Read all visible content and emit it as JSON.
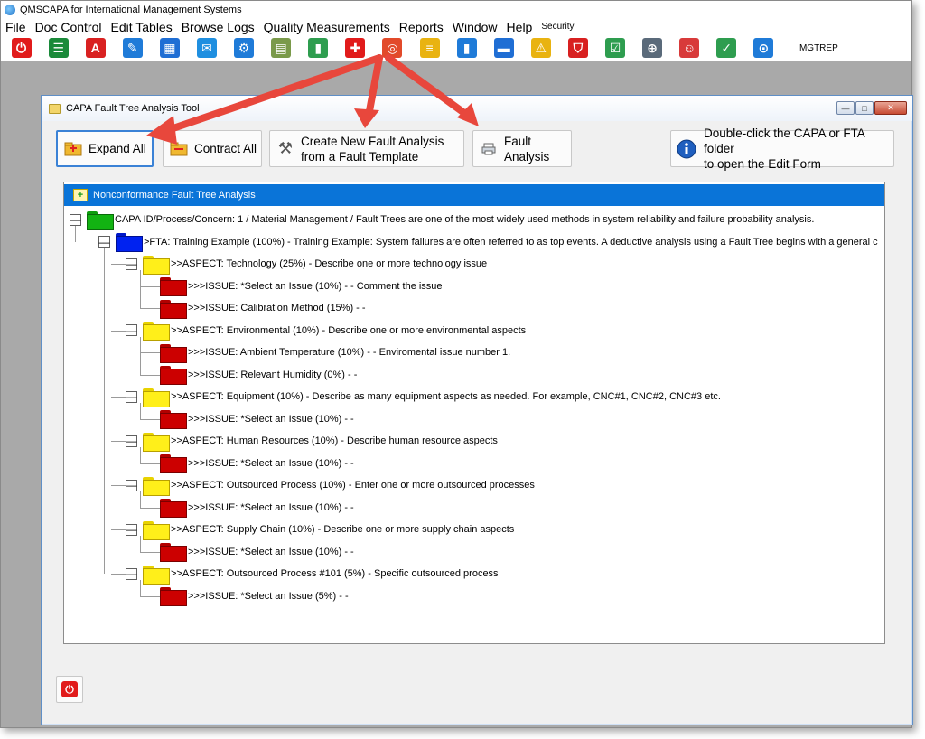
{
  "app": {
    "title": "QMSCAPA for International Management Systems"
  },
  "menu": [
    {
      "label": "File"
    },
    {
      "label": "Doc Control"
    },
    {
      "label": "Edit Tables"
    },
    {
      "label": "Browse Logs"
    },
    {
      "label": "Quality Measurements"
    },
    {
      "label": "Reports"
    },
    {
      "label": "Window"
    },
    {
      "label": "Help"
    },
    {
      "label": "Security",
      "small": true
    }
  ],
  "toolbar": {
    "icons": [
      {
        "name": "power-icon",
        "glyph": "⏻",
        "color": "#e11b1b"
      },
      {
        "name": "document-list-icon",
        "glyph": "☰",
        "color": "#1a8a3a"
      },
      {
        "name": "pdf-icon",
        "glyph": "A",
        "color": "#d92121"
      },
      {
        "name": "edit-pencil-icon",
        "glyph": "✎",
        "color": "#1f7bd8"
      },
      {
        "name": "org-chart-icon",
        "glyph": "▦",
        "color": "#1f6ed4"
      },
      {
        "name": "chat-icon",
        "glyph": "✉",
        "color": "#1f8fe0"
      },
      {
        "name": "gear-icon",
        "glyph": "⚙",
        "color": "#1f7bd8"
      },
      {
        "name": "calendar-icon",
        "glyph": "▤",
        "color": "#7a9a4a"
      },
      {
        "name": "book-icon",
        "glyph": "▮",
        "color": "#2e9d4f"
      },
      {
        "name": "red-cross-icon",
        "glyph": "✚",
        "color": "#e11b1b"
      },
      {
        "name": "lifebuoy-icon",
        "glyph": "◎",
        "color": "#e24a2a"
      },
      {
        "name": "notepad-icon",
        "glyph": "≡",
        "color": "#e9b311"
      },
      {
        "name": "bar-chart-icon",
        "glyph": "▮",
        "color": "#1f7bd8"
      },
      {
        "name": "printer-icon",
        "glyph": "▬",
        "color": "#1f6ed4"
      },
      {
        "name": "warning-icon",
        "glyph": "⚠",
        "color": "#e9b311"
      },
      {
        "name": "shield-icon",
        "glyph": "⛉",
        "color": "#d82020"
      },
      {
        "name": "checklist-icon",
        "glyph": "☑",
        "color": "#2e9d4f"
      },
      {
        "name": "database-add-icon",
        "glyph": "⊕",
        "color": "#5a6a7a"
      },
      {
        "name": "user-profile-icon",
        "glyph": "☺",
        "color": "#d83a3a"
      },
      {
        "name": "clipboard-check-icon",
        "glyph": "✓",
        "color": "#2e9d4f"
      },
      {
        "name": "globe-search-icon",
        "glyph": "⊙",
        "color": "#1f7bd8"
      }
    ],
    "mgtrep_label": "MGTREP"
  },
  "window": {
    "title": "CAPA Fault Tree Analysis Tool",
    "min_glyph": "—",
    "max_glyph": "□",
    "close_glyph": "✕"
  },
  "buttons": {
    "expand_all": "Expand All",
    "contract_all": "Contract All",
    "create_line1": "Create New Fault Analysis",
    "create_line2": "from a Fault Template",
    "fault_line1": "Fault",
    "fault_line2": "Analysis",
    "info_line1": "Double-click the CAPA or FTA folder",
    "info_line2": "to open the Edit Form"
  },
  "tree": {
    "header": "Nonconformance Fault Tree Analysis",
    "nodes": [
      {
        "level": 0,
        "color": "green",
        "expander": "—",
        "text": "CAPA ID/Process/Concern: 1 / Material Management / Fault Trees are one of the most widely used methods in system reliability and failure probability analysis."
      },
      {
        "level": 1,
        "color": "blue",
        "expander": "—",
        "text": ">FTA: Training Example (100%) - Training Example: System failures are often referred to as top events. A deductive analysis using a Fault Tree begins with a general c"
      },
      {
        "level": 2,
        "color": "yellow",
        "expander": "—",
        "text": ">>ASPECT: Technology (25%) - Describe one or more technology issue"
      },
      {
        "level": 3,
        "color": "red",
        "text": ">>>ISSUE: *Select an Issue (10%) -  - Comment the issue"
      },
      {
        "level": 3,
        "color": "red",
        "text": ">>>ISSUE: Calibration Method (15%) -  -"
      },
      {
        "level": 2,
        "color": "yellow",
        "expander": "—",
        "text": ">>ASPECT: Environmental (10%) - Describe one or more environmental aspects"
      },
      {
        "level": 3,
        "color": "red",
        "text": ">>>ISSUE: Ambient Temperature (10%) -  - Enviromental issue number 1."
      },
      {
        "level": 3,
        "color": "red",
        "text": ">>>ISSUE: Relevant Humidity (0%) -  -"
      },
      {
        "level": 2,
        "color": "yellow",
        "expander": "—",
        "text": ">>ASPECT: Equipment (10%) - Describe as many equipment aspects as needed. For example, CNC#1, CNC#2, CNC#3 etc."
      },
      {
        "level": 3,
        "color": "red",
        "text": ">>>ISSUE: *Select an Issue (10%) -  -"
      },
      {
        "level": 2,
        "color": "yellow",
        "expander": "—",
        "text": ">>ASPECT: Human Resources (10%) - Describe human resource aspects"
      },
      {
        "level": 3,
        "color": "red",
        "text": ">>>ISSUE: *Select an Issue (10%) -  -"
      },
      {
        "level": 2,
        "color": "yellow",
        "expander": "—",
        "text": ">>ASPECT: Outsourced Process (10%) - Enter one or more outsourced processes"
      },
      {
        "level": 3,
        "color": "red",
        "text": ">>>ISSUE: *Select an Issue (10%) -  -"
      },
      {
        "level": 2,
        "color": "yellow",
        "expander": "—",
        "text": ">>ASPECT: Supply Chain (10%) - Describe one or more supply chain aspects"
      },
      {
        "level": 3,
        "color": "red",
        "text": ">>>ISSUE: *Select an Issue (10%) -  -"
      },
      {
        "level": 2,
        "color": "yellow",
        "expander": "—",
        "text": ">>ASPECT: Outsourced Process #101 (5%) - Specific outsourced process"
      },
      {
        "level": 3,
        "color": "red",
        "text": ">>>ISSUE: *Select an Issue (5%) -  -"
      }
    ]
  },
  "colors": {
    "header_blue": "#0a74d8",
    "arrow_red": "#e8473c"
  }
}
